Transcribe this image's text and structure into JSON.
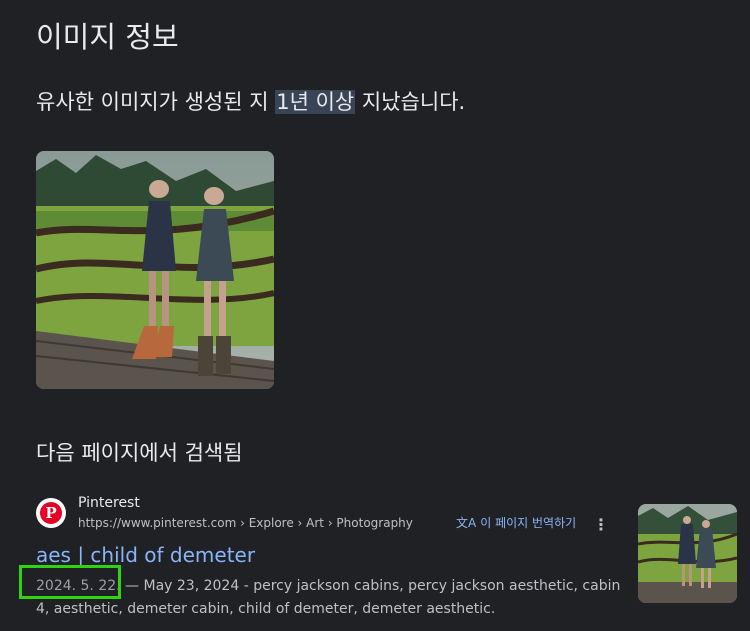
{
  "header": {
    "title": "이미지 정보",
    "subtitle_prefix": "유사한 이미지가 생성된 지 ",
    "subtitle_highlight": "1년 이상",
    "subtitle_suffix": " 지났습니다."
  },
  "section": {
    "title": "다음 페이지에서 검색됨"
  },
  "result": {
    "site_name": "Pinterest",
    "favicon_letter": "P",
    "breadcrumb": "https://www.pinterest.com › Explore › Art › Photography",
    "translate_icon": "文A",
    "translate_label": "이 페이지 번역하기",
    "more_icon": "⋮",
    "title": "aes | child of demeter",
    "date": "2024. 5. 22.",
    "snippet": " — May 23, 2024 - percy jackson cabins, percy jackson aesthetic, cabin 4, aesthetic, demeter cabin, child of demeter, demeter aesthetic."
  },
  "colors": {
    "background": "#202124",
    "link": "#8ab4f8",
    "highlight_bg": "#394457",
    "annotation_box": "#2fd40e",
    "pinterest_red": "#e60023"
  }
}
